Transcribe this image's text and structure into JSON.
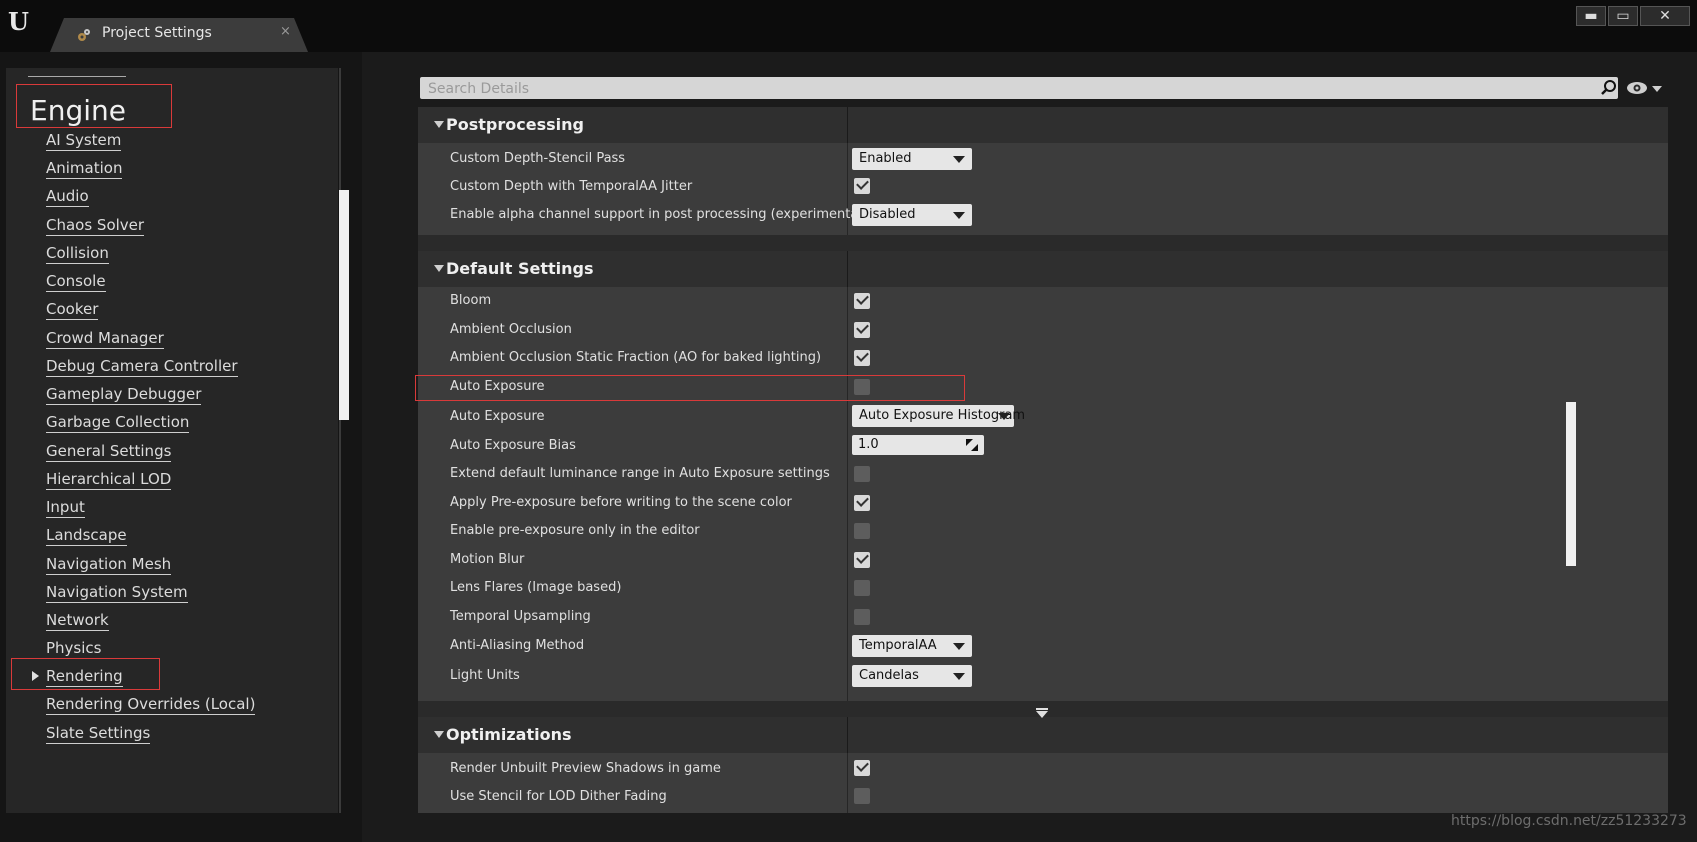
{
  "window": {
    "tab_label": "Project Settings",
    "tab_close": "×",
    "minimize": "▬",
    "maximize": "▭",
    "close": "✕"
  },
  "left_panel": {
    "heading": "Engine",
    "items": [
      {
        "label": "AI System"
      },
      {
        "label": "Animation"
      },
      {
        "label": "Audio"
      },
      {
        "label": "Chaos Solver"
      },
      {
        "label": "Collision"
      },
      {
        "label": "Console"
      },
      {
        "label": "Cooker"
      },
      {
        "label": "Crowd Manager"
      },
      {
        "label": "Debug Camera Controller"
      },
      {
        "label": "Gameplay Debugger"
      },
      {
        "label": "Garbage Collection"
      },
      {
        "label": "General Settings"
      },
      {
        "label": "Hierarchical LOD"
      },
      {
        "label": "Input"
      },
      {
        "label": "Landscape"
      },
      {
        "label": "Navigation Mesh"
      },
      {
        "label": "Navigation System"
      },
      {
        "label": "Network"
      },
      {
        "label": "Physics"
      },
      {
        "label": "Rendering"
      },
      {
        "label": "Rendering Overrides (Local)"
      },
      {
        "label": "Slate Settings"
      }
    ],
    "selected": "Rendering"
  },
  "search": {
    "placeholder": "Search Details",
    "value": ""
  },
  "categories": {
    "postprocessing": {
      "title": "Postprocessing",
      "rows": [
        {
          "name": "Custom Depth-Stencil Pass",
          "type": "dropdown",
          "value": "Enabled"
        },
        {
          "name": "Custom Depth with TemporalAA Jitter",
          "type": "checkbox",
          "checked": true
        },
        {
          "name": "Enable alpha channel support in post processing (experimental).",
          "type": "dropdown",
          "value": "Disabled"
        }
      ]
    },
    "default_settings": {
      "title": "Default Settings",
      "rows": [
        {
          "name": "Bloom",
          "type": "checkbox",
          "checked": true
        },
        {
          "name": "Ambient Occlusion",
          "type": "checkbox",
          "checked": true
        },
        {
          "name": "Ambient Occlusion Static Fraction (AO for baked lighting)",
          "type": "checkbox",
          "checked": true
        },
        {
          "name": "Auto Exposure",
          "type": "checkbox",
          "checked": false
        },
        {
          "name": "Auto Exposure",
          "type": "dropdown",
          "value": "Auto Exposure Histogram"
        },
        {
          "name": "Auto Exposure Bias",
          "type": "number",
          "value": "1.0"
        },
        {
          "name": "Extend default luminance range in Auto Exposure settings",
          "type": "checkbox",
          "checked": false
        },
        {
          "name": "Apply Pre-exposure before writing to the scene color",
          "type": "checkbox",
          "checked": true
        },
        {
          "name": "Enable pre-exposure only in the editor",
          "type": "checkbox",
          "checked": false
        },
        {
          "name": "Motion Blur",
          "type": "checkbox",
          "checked": true
        },
        {
          "name": "Lens Flares (Image based)",
          "type": "checkbox",
          "checked": false
        },
        {
          "name": "Temporal Upsampling",
          "type": "checkbox",
          "checked": false
        },
        {
          "name": "Anti-Aliasing Method",
          "type": "dropdown",
          "value": "TemporalAA"
        },
        {
          "name": "Light Units",
          "type": "dropdown",
          "value": "Candelas"
        }
      ]
    },
    "optimizations": {
      "title": "Optimizations",
      "rows": [
        {
          "name": "Render Unbuilt Preview Shadows in game",
          "type": "checkbox",
          "checked": true
        },
        {
          "name": "Use Stencil for LOD Dither Fading",
          "type": "checkbox",
          "checked": false
        }
      ]
    }
  },
  "watermark": "https://blog.csdn.net/zz51233273",
  "colors": {
    "highlight": "#d93a3a",
    "panel_bg": "#262626",
    "row_bg": "#3c3c3c",
    "category_bg": "#2f2f2f"
  }
}
